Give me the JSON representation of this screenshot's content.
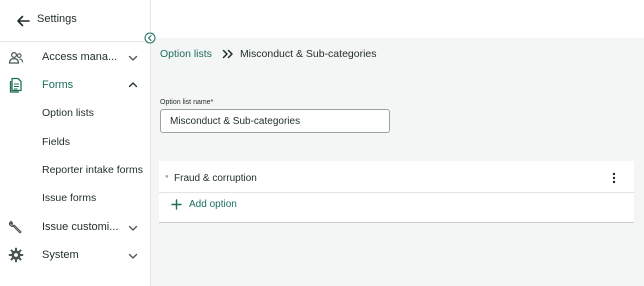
{
  "sidebar": {
    "title": "Settings",
    "items": [
      {
        "label": "Access mana...",
        "icon": "users-icon",
        "expanded": false
      },
      {
        "label": "Forms",
        "icon": "document-icon",
        "expanded": true
      },
      {
        "label": "Issue customi...",
        "icon": "wrench-icon",
        "expanded": false
      },
      {
        "label": "System",
        "icon": "gear-icon",
        "expanded": false
      }
    ],
    "forms_subitems": [
      {
        "label": "Option lists"
      },
      {
        "label": "Fields"
      },
      {
        "label": "Reporter intake forms"
      },
      {
        "label": "Issue forms"
      }
    ]
  },
  "breadcrumb": {
    "parent": "Option lists",
    "current": "Misconduct & Sub-categories"
  },
  "form": {
    "name_label": "Option list name*",
    "name_value": "Misconduct & Sub-categories"
  },
  "options": {
    "items": [
      {
        "label": "Fraud & corruption"
      }
    ],
    "add_label": "Add option"
  },
  "colors": {
    "accent": "#1c6e5b",
    "text": "#1f2d2a",
    "main_bg": "#f4f5f5",
    "border": "#e2e5e4"
  }
}
